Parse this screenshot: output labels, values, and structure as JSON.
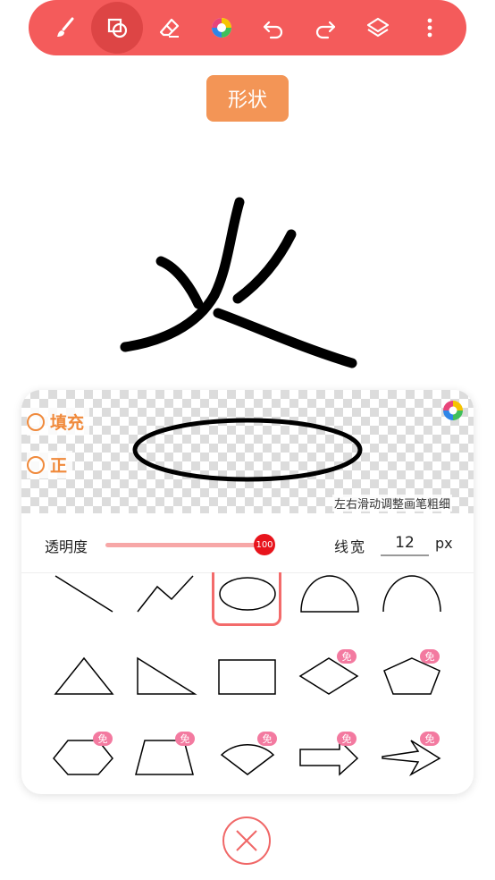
{
  "toolbar": {
    "tools": [
      {
        "name": "brush-icon"
      },
      {
        "name": "shape-icon",
        "active": true
      },
      {
        "name": "eraser-icon"
      },
      {
        "name": "color-wheel-icon"
      },
      {
        "name": "undo-icon"
      },
      {
        "name": "redo-icon"
      },
      {
        "name": "layers-icon"
      },
      {
        "name": "more-vertical-icon"
      }
    ],
    "accent": "#f45b5b"
  },
  "title": "形状",
  "panel": {
    "fill_label": "填充",
    "regular_label": "正",
    "hint": "左右滑动调整画笔粗细",
    "opacity_label": "透明度",
    "opacity_value": "100",
    "linewidth_label": "线宽",
    "linewidth_value": "12",
    "linewidth_unit": "px",
    "free_badge": "免"
  },
  "shapes": [
    {
      "name": "line"
    },
    {
      "name": "polyline"
    },
    {
      "name": "ellipse",
      "selected": true
    },
    {
      "name": "semicircle"
    },
    {
      "name": "arc"
    },
    {
      "name": "triangle"
    },
    {
      "name": "right-triangle"
    },
    {
      "name": "rectangle"
    },
    {
      "name": "rhombus",
      "badge": true
    },
    {
      "name": "pentagon",
      "badge": true
    },
    {
      "name": "hexagon",
      "badge": true
    },
    {
      "name": "trapezoid",
      "badge": true
    },
    {
      "name": "sector",
      "badge": true
    },
    {
      "name": "arrow",
      "badge": true
    },
    {
      "name": "star-arrow",
      "badge": true
    }
  ]
}
